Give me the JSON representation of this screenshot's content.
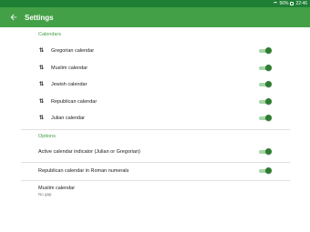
{
  "status_bar": {
    "battery": "56%",
    "time": "22:46"
  },
  "app_bar": {
    "title": "Settings",
    "back_icon": "arrow-back-icon"
  },
  "sections": {
    "calendars_header": "Calendars",
    "options_header": "Options"
  },
  "calendars": [
    {
      "label": "Gregorian calendar",
      "enabled": true
    },
    {
      "label": "Muslim calendar",
      "enabled": true
    },
    {
      "label": "Jewish calendar",
      "enabled": true
    },
    {
      "label": "Republican calendar",
      "enabled": true
    },
    {
      "label": "Julian calendar",
      "enabled": true
    }
  ],
  "options": [
    {
      "label": "Active calendar indicator (Julian or Gregorian)",
      "enabled": true
    },
    {
      "label": "Republican calendar in Roman numerals",
      "enabled": true
    },
    {
      "label": "Muslim calendar",
      "sublabel": "No gap"
    }
  ],
  "colors": {
    "accent": "#43a047",
    "status_bar": "#1e7e34",
    "toggle_thumb": "#2e7d32",
    "toggle_track": "#a5d6a7"
  },
  "icons": {
    "reorder": "swap-vertical-icon"
  }
}
